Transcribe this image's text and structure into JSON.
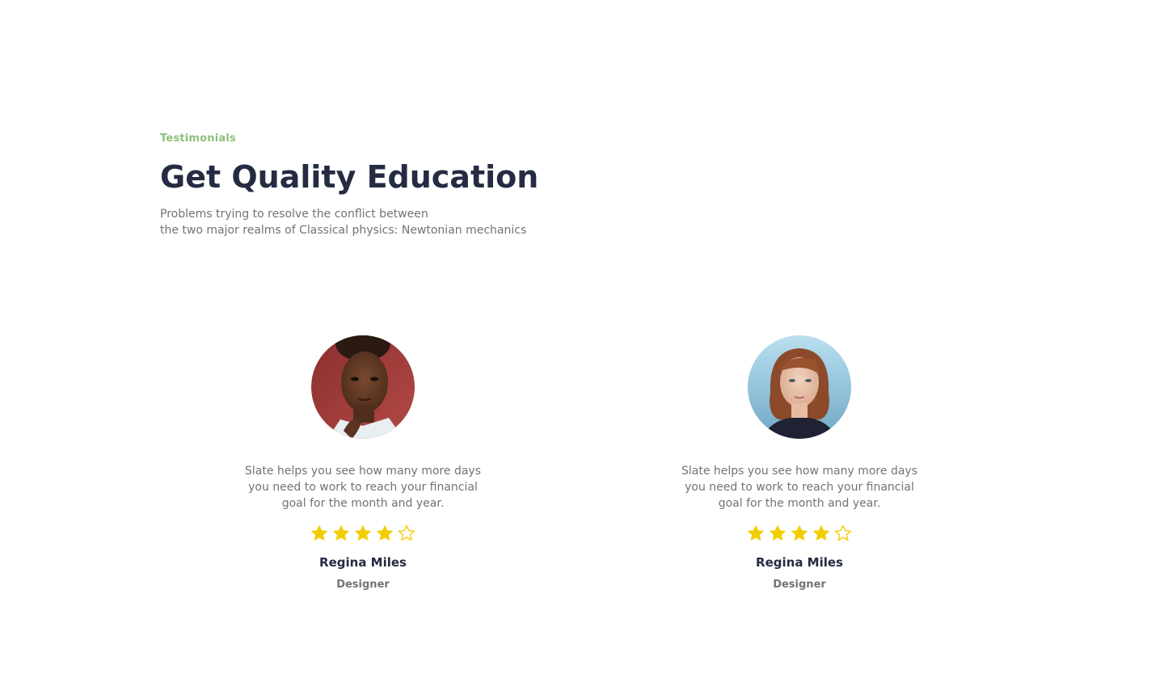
{
  "header": {
    "eyebrow": "Testimonials",
    "title": "Get Quality Education",
    "subtitle_line1": "Problems trying to resolve the conflict between",
    "subtitle_line2": "the two major realms of Classical physics: Newtonian mechanics"
  },
  "colors": {
    "accent": "#8ec07c",
    "heading": "#252b42",
    "text": "#737373",
    "star": "#f3cd03"
  },
  "testimonials": [
    {
      "avatar_icon": "avatar-photo",
      "quote_line1": "Slate helps you see how many more days",
      "quote_line2": "you need to work to reach your financial",
      "quote_line3": "goal for the month and year.",
      "rating": 4,
      "rating_max": 5,
      "name": "Regina Miles",
      "role": "Designer"
    },
    {
      "avatar_icon": "avatar-photo",
      "quote_line1": "Slate helps you see how many more days",
      "quote_line2": "you need to work to reach your financial",
      "quote_line3": "goal for the month and year.",
      "rating": 4,
      "rating_max": 5,
      "name": "Regina Miles",
      "role": "Designer"
    }
  ]
}
